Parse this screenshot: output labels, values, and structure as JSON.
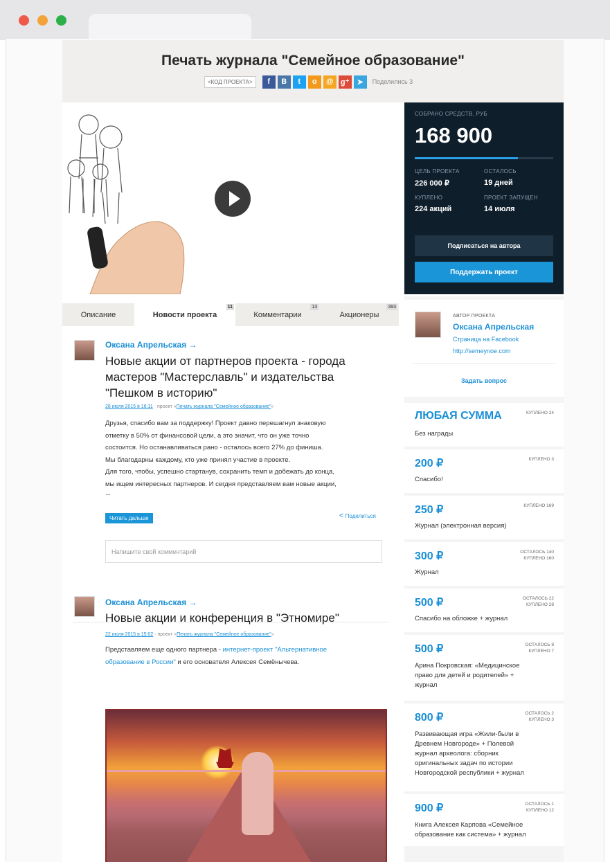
{
  "project": {
    "title": "Печать журнала \"Семейное образование\"",
    "code_button": "<КОД ПРОЕКТА>",
    "shared_text": "Поделились 3"
  },
  "social": [
    {
      "name": "facebook-icon",
      "glyph": "f",
      "color": "#3b5998"
    },
    {
      "name": "vk-icon",
      "glyph": "В",
      "color": "#4a76a8"
    },
    {
      "name": "twitter-icon",
      "glyph": "t",
      "color": "#1da1f2"
    },
    {
      "name": "odnoklassniki-icon",
      "glyph": "о",
      "color": "#f39a1e"
    },
    {
      "name": "mail-icon",
      "glyph": "@",
      "color": "#f5a623"
    },
    {
      "name": "google-plus-icon",
      "glyph": "g⁺",
      "color": "#dd4b39"
    },
    {
      "name": "telegram-icon",
      "glyph": "➤",
      "color": "#3aa6e0"
    }
  ],
  "funding": {
    "collected_label": "СОБРАНО СРЕДСТВ, РУБ",
    "collected": "168 900",
    "progress": 0.747,
    "goal_label": "ЦЕЛЬ ПРОЕКТА",
    "goal": "226 000 ₽",
    "left_label": "ОСТАЛОСЬ",
    "left": "19 дней",
    "bought_label": "КУПЛЕНО",
    "bought": "224 акций",
    "launched_label": "ПРОЕКТ ЗАПУЩЕН",
    "launched": "14 июля",
    "subscribe_button": "Подписаться на автора",
    "support_button": "Поддержать проект"
  },
  "tabs": [
    {
      "label": "Описание",
      "count": ""
    },
    {
      "label": "Новости проекта",
      "count": "11"
    },
    {
      "label": "Комментарии",
      "count": "13"
    },
    {
      "label": "Акционеры",
      "count": "393"
    }
  ],
  "posts": [
    {
      "author": "Оксана Апрельская →",
      "title": "Новые акции от партнеров проекта - города мастеров \"Мастерславль\" и издательства \"Пешком в историю\"",
      "date": "28 июля 2015 в 16:11",
      "project_prefix": "· проект «",
      "project_link": "Печать журнала \"Семейное образование\"",
      "project_suffix": "»",
      "body": [
        "Друзья, спасибо вам за поддержку! Проект давно перешагнул знаковую",
        "отметку в 50% от финансовой цели, а это значит, что он уже точно",
        "состоится. Но останавливаться рано - осталось всего 27% до финиша.",
        "Мы благодарны каждому, кто уже принял участие в проекте.",
        "Для того, чтобы, успешно стартанув, сохранить темп и добежать до конца,",
        "мы ищем интересных партнеров. И сегдня представляем вам новые акции,",
        "..."
      ],
      "read_more": "Читать дальше",
      "share": "Поделиться",
      "comment_placeholder": "Напишите свой комментарий"
    },
    {
      "author": "Оксана Апрельская →",
      "title": "Новые акции и конференция в \"Этномире\"",
      "date": "22 июля 2015 в 15:02",
      "project_prefix": "· проект «",
      "project_link": "Печать журнала \"Семейное образование\"",
      "project_suffix": "»",
      "body_intro": "Представляем еще одного партнера - ",
      "body_link1": "интернет-проект \"Альтернативное",
      "body_link2": "образование в России\"",
      "body_tail": " и его основателя Алексея Семёнычева."
    }
  ],
  "author_card": {
    "caption": "АВТОР ПРОЕКТА",
    "name": "Оксана Апрельская",
    "facebook": "Страница на Facebook",
    "site": "http://semeynoe.com",
    "ask": "Задать вопрос"
  },
  "rewards": [
    {
      "amount": "ЛЮБАЯ СУММА",
      "stat1": "КУПЛЕНО 24",
      "stat2": "",
      "desc": [
        "Без награды"
      ]
    },
    {
      "amount": "200 ₽",
      "stat1": "КУПЛЕНО 3",
      "stat2": "",
      "desc": [
        "Спасибо!"
      ]
    },
    {
      "amount": "250 ₽",
      "stat1": "КУПЛЕНО 169",
      "stat2": "",
      "desc": [
        "Журнал (электронная версия)"
      ]
    },
    {
      "amount": "300 ₽",
      "stat1": "ОСТАЛОСЬ 140",
      "stat2": "КУПЛЕНО 160",
      "desc": [
        "Журнал"
      ]
    },
    {
      "amount": "500 ₽",
      "stat1": "ОСТАЛОСЬ 22",
      "stat2": "КУПЛЕНО 28",
      "desc": [
        "Спасибо на обложке + журнал"
      ]
    },
    {
      "amount": "500 ₽",
      "stat1": "ОСТАЛОСЬ 8",
      "stat2": "КУПЛЕНО 7",
      "desc": [
        "Арина Покровская: «Медицинское",
        "право для детей и родителей» +",
        "журнал"
      ]
    },
    {
      "amount": "800 ₽",
      "stat1": "ОСТАЛОСЬ 2",
      "stat2": "КУПЛЕНО 3",
      "desc": [
        "Развивающая игра «Жили-были в",
        "Древнем Новгороде» + Полевой",
        "журнал археолога: сборник",
        "оригинальных задач по истории",
        "Новгородской республики + журнал"
      ]
    },
    {
      "amount": "900 ₽",
      "stat1": "ОСТАЛОСЬ 1",
      "stat2": "КУПЛЕНО 12",
      "desc": [
        "Книга Алексея Карпова «Семейное",
        "образование как система» + журнал"
      ]
    }
  ]
}
